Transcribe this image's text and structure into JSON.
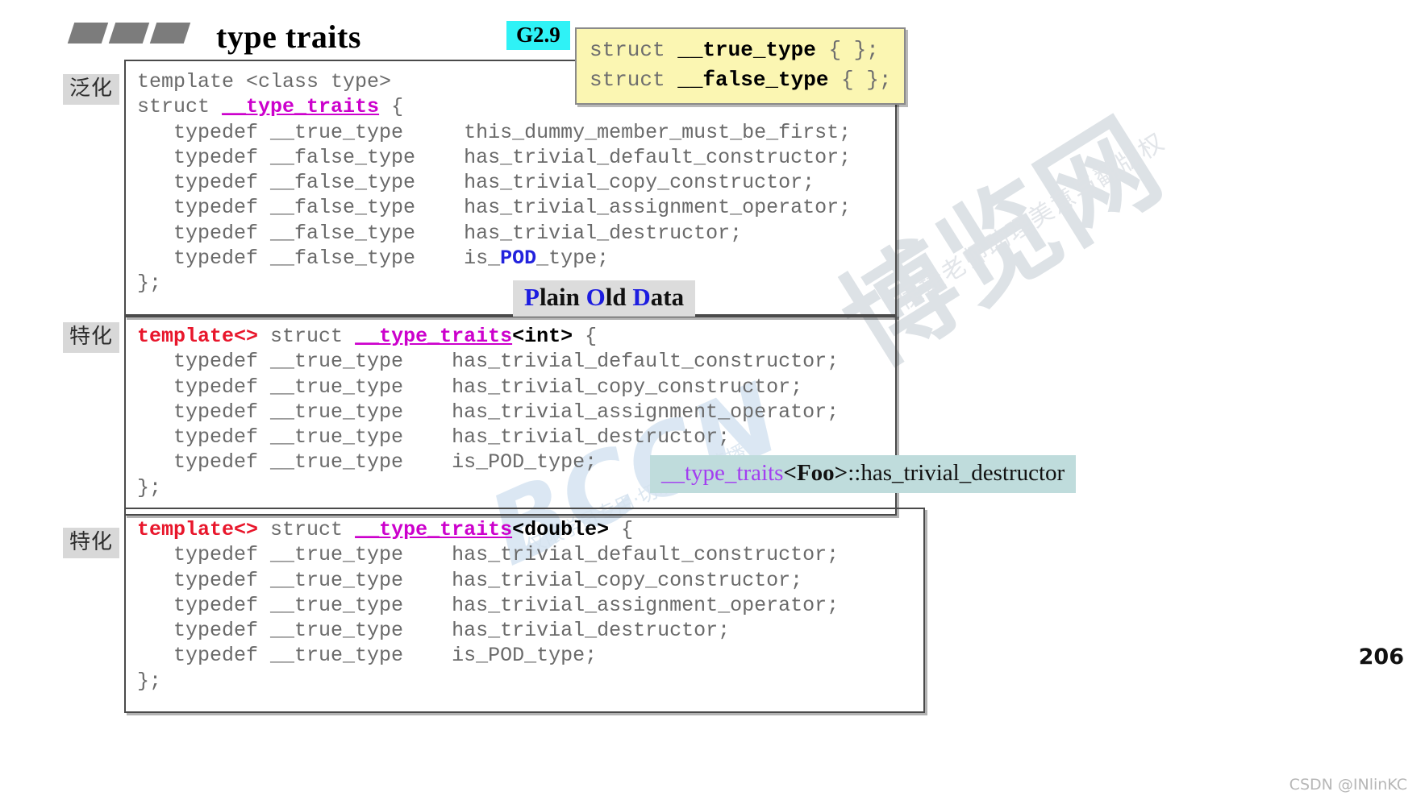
{
  "header": {
    "title": "type traits",
    "tag": "G2.9",
    "decor_bars": 3
  },
  "note_yellow": {
    "line1_prefix": "struct ",
    "line1_name": "__true_type",
    "line1_suffix": " { };",
    "line2_prefix": "struct ",
    "line2_name": "__false_type",
    "line2_suffix": " { };"
  },
  "side_labels": {
    "generic": "泛化",
    "specialized_1": "特化",
    "specialized_2": "特化"
  },
  "code_blocks": [
    {
      "name": "generic-type-traits",
      "header_template": "template <class type>",
      "header_struct": "struct ",
      "header_traits": "__type_traits",
      "header_open": " {",
      "rows": [
        {
          "typedef": "typedef __true_type",
          "member": "this_dummy_member_must_be_first;"
        },
        {
          "typedef": "typedef __false_type",
          "member": "has_trivial_default_constructor;"
        },
        {
          "typedef": "typedef __false_type",
          "member": "has_trivial_copy_constructor;"
        },
        {
          "typedef": "typedef __false_type",
          "member": "has_trivial_assignment_operator;"
        },
        {
          "typedef": "typedef __false_type",
          "member": "has_trivial_destructor;"
        },
        {
          "typedef": "typedef __false_type",
          "member_pre": "is_",
          "member_pod": "POD",
          "member_post": "_type;"
        }
      ],
      "close": "};"
    },
    {
      "name": "int-specialization",
      "header_kw": "template<>",
      "header_struct": " struct ",
      "header_traits": "__type_traits",
      "header_spec": "<int>",
      "header_open": " {",
      "rows": [
        {
          "typedef": "typedef __true_type",
          "member": "has_trivial_default_constructor;"
        },
        {
          "typedef": "typedef __true_type",
          "member": "has_trivial_copy_constructor;"
        },
        {
          "typedef": "typedef __true_type",
          "member": "has_trivial_assignment_operator;"
        },
        {
          "typedef": "typedef __true_type",
          "member": "has_trivial_destructor;"
        },
        {
          "typedef": "typedef __true_type",
          "member": "is_POD_type;"
        }
      ],
      "close": "};"
    },
    {
      "name": "double-specialization",
      "header_kw": "template<>",
      "header_struct": " struct ",
      "header_traits": "__type_traits",
      "header_spec": "<double>",
      "header_open": " {",
      "rows": [
        {
          "typedef": "typedef __true_type",
          "member": "has_trivial_default_constructor;"
        },
        {
          "typedef": "typedef __true_type",
          "member": "has_trivial_copy_constructor;"
        },
        {
          "typedef": "typedef __true_type",
          "member": "has_trivial_assignment_operator;"
        },
        {
          "typedef": "typedef __true_type",
          "member": "has_trivial_destructor;"
        },
        {
          "typedef": "typedef __true_type",
          "member": "is_POD_type;"
        }
      ],
      "close": "};"
    }
  ],
  "pod_tag": {
    "p": "P",
    "lain": "lain ",
    "o": "O",
    "ld": "ld ",
    "d": "D",
    "ata": "ata"
  },
  "callout_teal": {
    "traits": "__type_traits",
    "open": "<",
    "foo": "Foo",
    "close": ">",
    "member": "::has_trivial_destructor"
  },
  "footer": {
    "page_number": "206",
    "watermark_credit": "CSDN @INlinKC"
  },
  "watermarks": {
    "bolan": "博览网",
    "bolan_sub": "侯捷老师助理美意与翻版权",
    "bccn": "BCCN",
    "bccn_sub": "仅限学员专用·切勿散布传播"
  },
  "colors": {
    "accent_cyan": "#2ff2f6",
    "note_yellow": "#fbf6b2",
    "traits_magenta": "#cc00cc",
    "template_red": "#e8162b",
    "pod_blue": "#2222dd",
    "callout_teal": "#bfdcdc",
    "label_gray": "#d8d8d8"
  }
}
